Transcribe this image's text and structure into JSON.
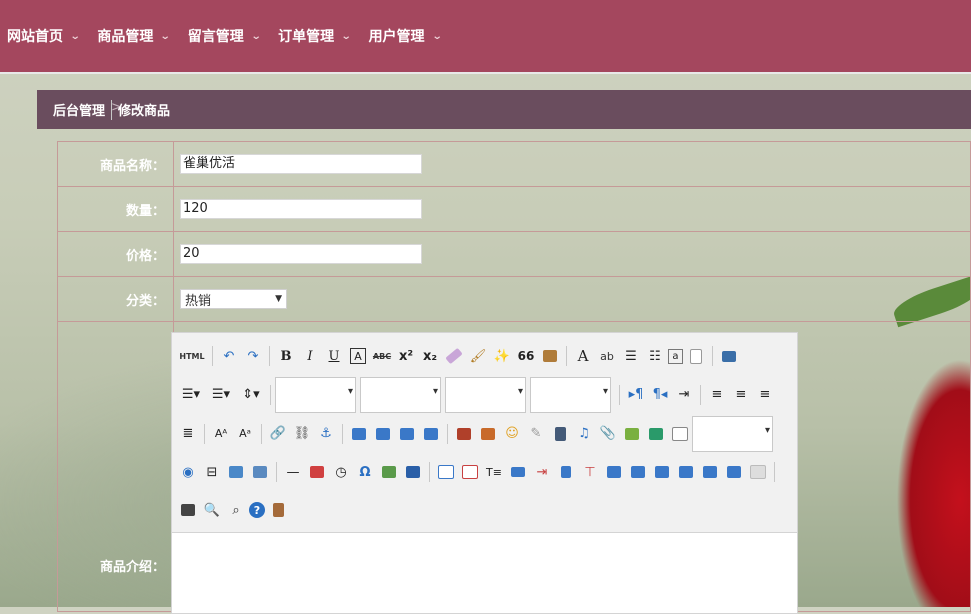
{
  "nav": {
    "items": [
      {
        "label": "网站首页"
      },
      {
        "label": "商品管理"
      },
      {
        "label": "留言管理"
      },
      {
        "label": "订单管理"
      },
      {
        "label": "用户管理"
      }
    ]
  },
  "breadcrumb": {
    "root": "后台管理",
    "separator": ">",
    "current": "修改商品"
  },
  "form": {
    "name_label": "商品名称：",
    "name_value": "雀巢优活",
    "qty_label": "数量：",
    "qty_value": "120",
    "price_label": "价格：",
    "price_value": "20",
    "category_label": "分类：",
    "category_value": "热销",
    "desc_label": "商品介绍："
  },
  "editor": {
    "html_button": "HTML",
    "bold": "B",
    "italic": "I",
    "underline": "U",
    "quote": "66",
    "font_color": "A",
    "omega": "Ω"
  },
  "colors": {
    "nav_bg": "#a4475e",
    "crumb_bg": "#6a4d5e",
    "table_border": "#c59a98"
  }
}
